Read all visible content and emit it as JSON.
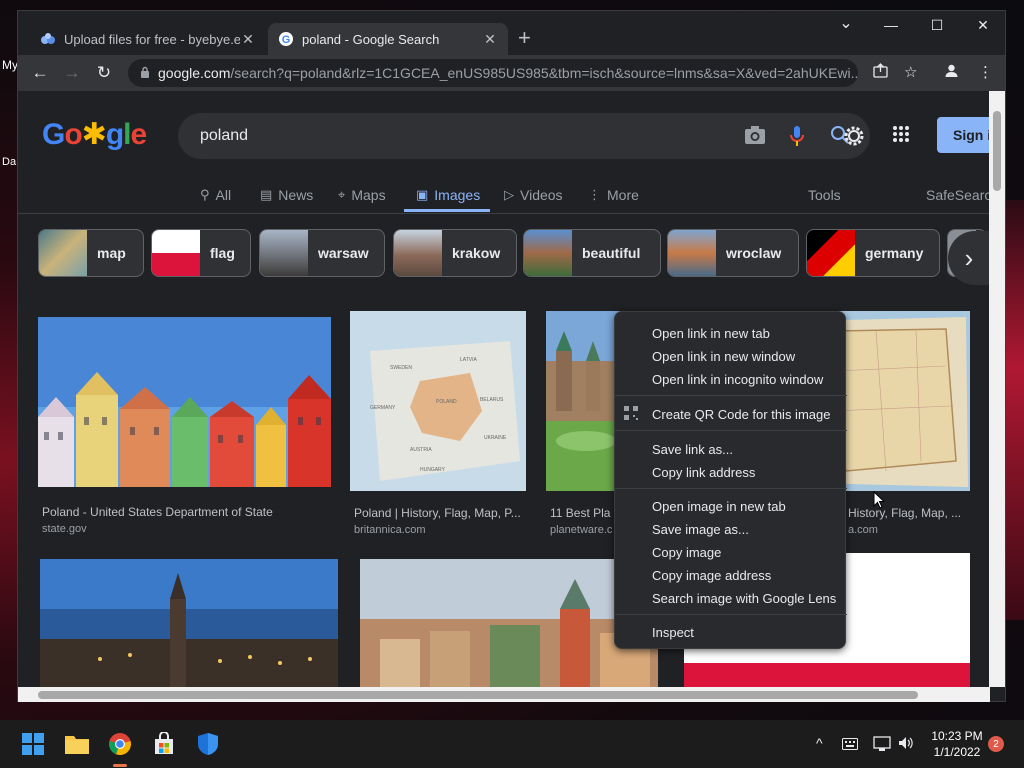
{
  "desktop": {
    "label_top": "My",
    "label_mid": "Da"
  },
  "tabs": [
    {
      "title": "Upload files for free - byebye.exe",
      "favicon": "upload-icon",
      "close": "✕"
    },
    {
      "title": "poland - Google Search",
      "favicon": "google-icon",
      "close": "✕"
    }
  ],
  "window_controls": {
    "new_tab": "+",
    "dropdown": "⌄",
    "minimize": "—",
    "maximize": "☐",
    "close": "✕"
  },
  "toolbar": {
    "back": "←",
    "forward": "→",
    "reload": "↻",
    "url_host": "google.com",
    "url_path": "/search?q=poland&rlz=1C1GCEA_enUS985US985&tbm=isch&source=lnms&sa=X&ved=2ahUKEwi..."
  },
  "google": {
    "query": "poland",
    "sign_in": "Sign i",
    "filters": [
      {
        "label": "All",
        "icon": "search-icon"
      },
      {
        "label": "News",
        "icon": "news-icon"
      },
      {
        "label": "Maps",
        "icon": "pin-icon"
      },
      {
        "label": "Images",
        "icon": "image-icon",
        "active": true
      },
      {
        "label": "Videos",
        "icon": "video-icon"
      },
      {
        "label": "More",
        "icon": "more-icon"
      }
    ],
    "tools": "Tools",
    "safesearch": "SafeSearch",
    "chips": [
      "map",
      "flag",
      "warsaw",
      "krakow",
      "beautiful",
      "wroclaw",
      "germany"
    ],
    "results": [
      {
        "caption": "Poland - United States Department of State",
        "source": "state.gov"
      },
      {
        "caption": "Poland | History, Flag, Map, P...",
        "source": "britannica.com"
      },
      {
        "caption": "11 Best Pla",
        "source": "planetware.c"
      },
      {
        "caption": "History, Flag, Map, ...",
        "source": "a.com"
      }
    ]
  },
  "context_menu": {
    "items": [
      "Open link in new tab",
      "Open link in new window",
      "Open link in incognito window",
      "Create QR Code for this image",
      "Save link as...",
      "Copy link address",
      "Open image in new tab",
      "Save image as...",
      "Copy image",
      "Copy image address",
      "Search image with Google Lens",
      "Inspect"
    ]
  },
  "taskbar": {
    "time": "10:23 PM",
    "date": "1/1/2022",
    "notifications": "2"
  },
  "colors": {
    "accent": "#8ab4f8",
    "page_bg": "#202124"
  }
}
